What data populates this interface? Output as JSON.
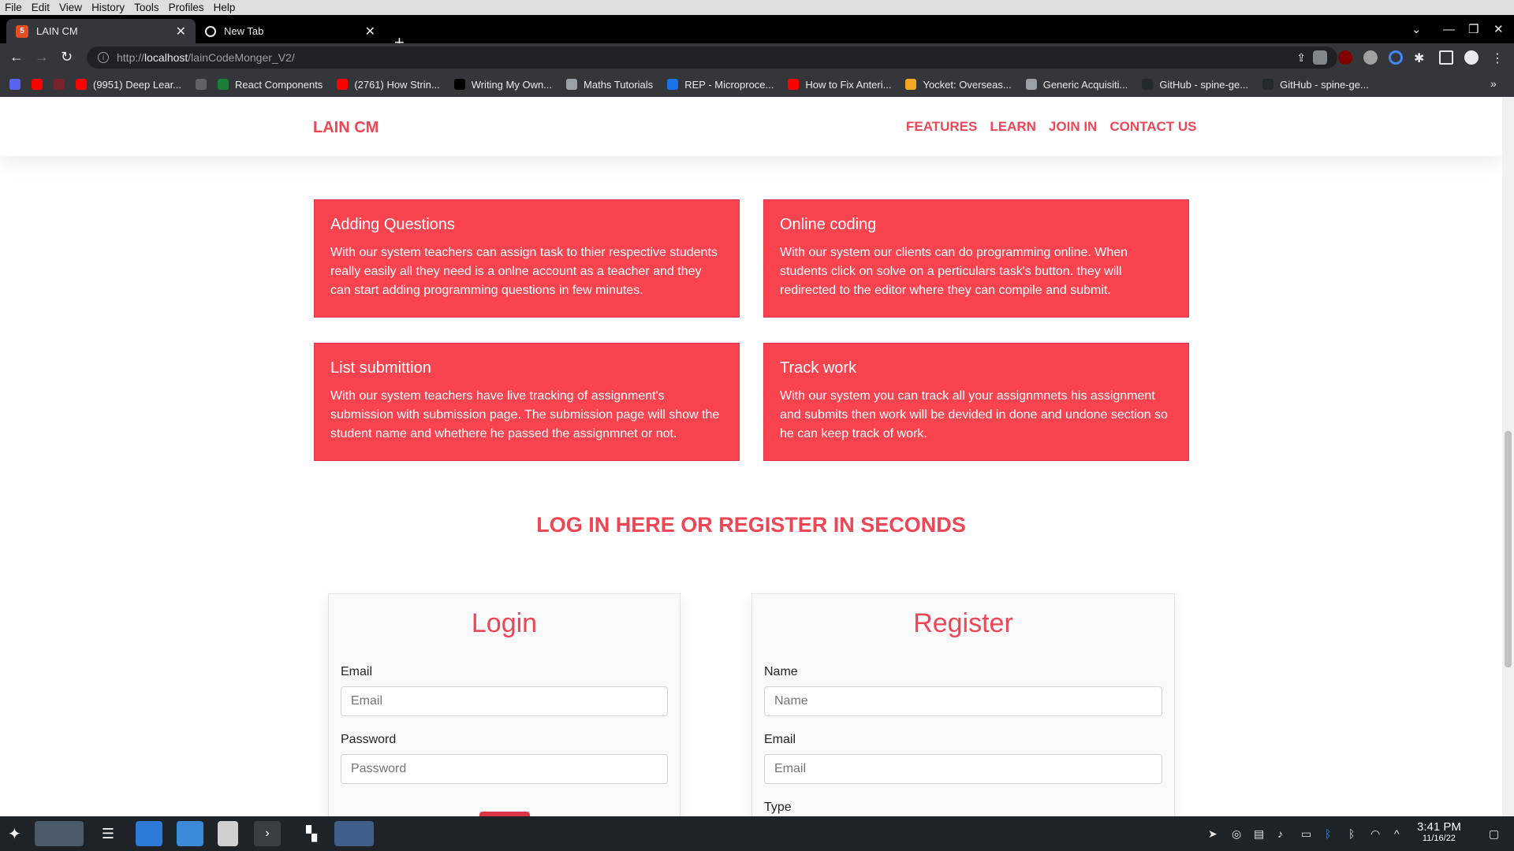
{
  "menubar": {
    "items": [
      "File",
      "Edit",
      "View",
      "History",
      "Tools",
      "Profiles",
      "Help"
    ]
  },
  "tabs": [
    {
      "title": "LAIN CM",
      "active": true
    },
    {
      "title": "New Tab",
      "active": false
    }
  ],
  "window_controls": {
    "dropdown": "⌄",
    "minimize": "—",
    "maximize": "❐",
    "close": "✕"
  },
  "address_bar": {
    "scheme": "http://",
    "host": "localhost",
    "path": "/lainCodeMonger_V2/"
  },
  "bookmarks": [
    {
      "label": "",
      "color": "#5865f2"
    },
    {
      "label": "",
      "color": "#ff0000"
    },
    {
      "label": "",
      "color": "#7b2230"
    },
    {
      "label": "(9951) Deep Lear...",
      "color": "#ff0000"
    },
    {
      "label": "",
      "color": "#5f6368"
    },
    {
      "label": "React Components",
      "color": "#1a7f37"
    },
    {
      "label": "(2761) How Strin...",
      "color": "#ff0000"
    },
    {
      "label": "Writing My Own...",
      "color": "#000000"
    },
    {
      "label": "Maths Tutorials",
      "color": "#9aa0a6"
    },
    {
      "label": "REP - Microproce...",
      "color": "#1a73e8"
    },
    {
      "label": "How to Fix Anteri...",
      "color": "#ff0000"
    },
    {
      "label": "Yocket: Overseas...",
      "color": "#f5a623"
    },
    {
      "label": "Generic Acquisiti...",
      "color": "#9aa0a6"
    },
    {
      "label": "GitHub - spine-ge...",
      "color": "#24292e"
    },
    {
      "label": "GitHub - spine-ge...",
      "color": "#24292e"
    }
  ],
  "bookmarks_overflow": "»",
  "site": {
    "brand": "LAIN CM",
    "nav": [
      "FEATURES",
      "LEARN",
      "JOIN IN",
      "CONTACT US"
    ],
    "features": [
      {
        "title": "Adding Questions",
        "text": "With our system teachers can assign task to thier respective students really easily all they need is a onlne account as a teacher and they can start adding programming questions in few minutes."
      },
      {
        "title": "Online coding",
        "text": "With our system our clients can do programming online. When students click on solve on a perticulars task's button. they will redirected to the editor where they can compile and submit."
      },
      {
        "title": "List submittion",
        "text": "With our system teachers have live tracking of assignment's submission with submission page. The submission page will show the student name and whethere he passed the assignmnet or not."
      },
      {
        "title": "Track work",
        "text": "With our system you can track all your assignmnets his assignment and submits then work will be devided in done and undone section so he can keep track of work."
      }
    ],
    "cta": "LOG IN HERE OR REGISTER IN SECONDS",
    "login": {
      "title": "Login",
      "email_label": "Email",
      "email_placeholder": "Email",
      "password_label": "Password",
      "password_placeholder": "Password"
    },
    "register": {
      "title": "Register",
      "name_label": "Name",
      "name_placeholder": "Name",
      "email_label": "Email",
      "email_placeholder": "Email",
      "type_label": "Type"
    }
  },
  "colors": {
    "accent": "#ef4655",
    "card": "#f9434f"
  },
  "taskbar": {
    "time": "3:41 PM",
    "date": "11/16/22"
  }
}
